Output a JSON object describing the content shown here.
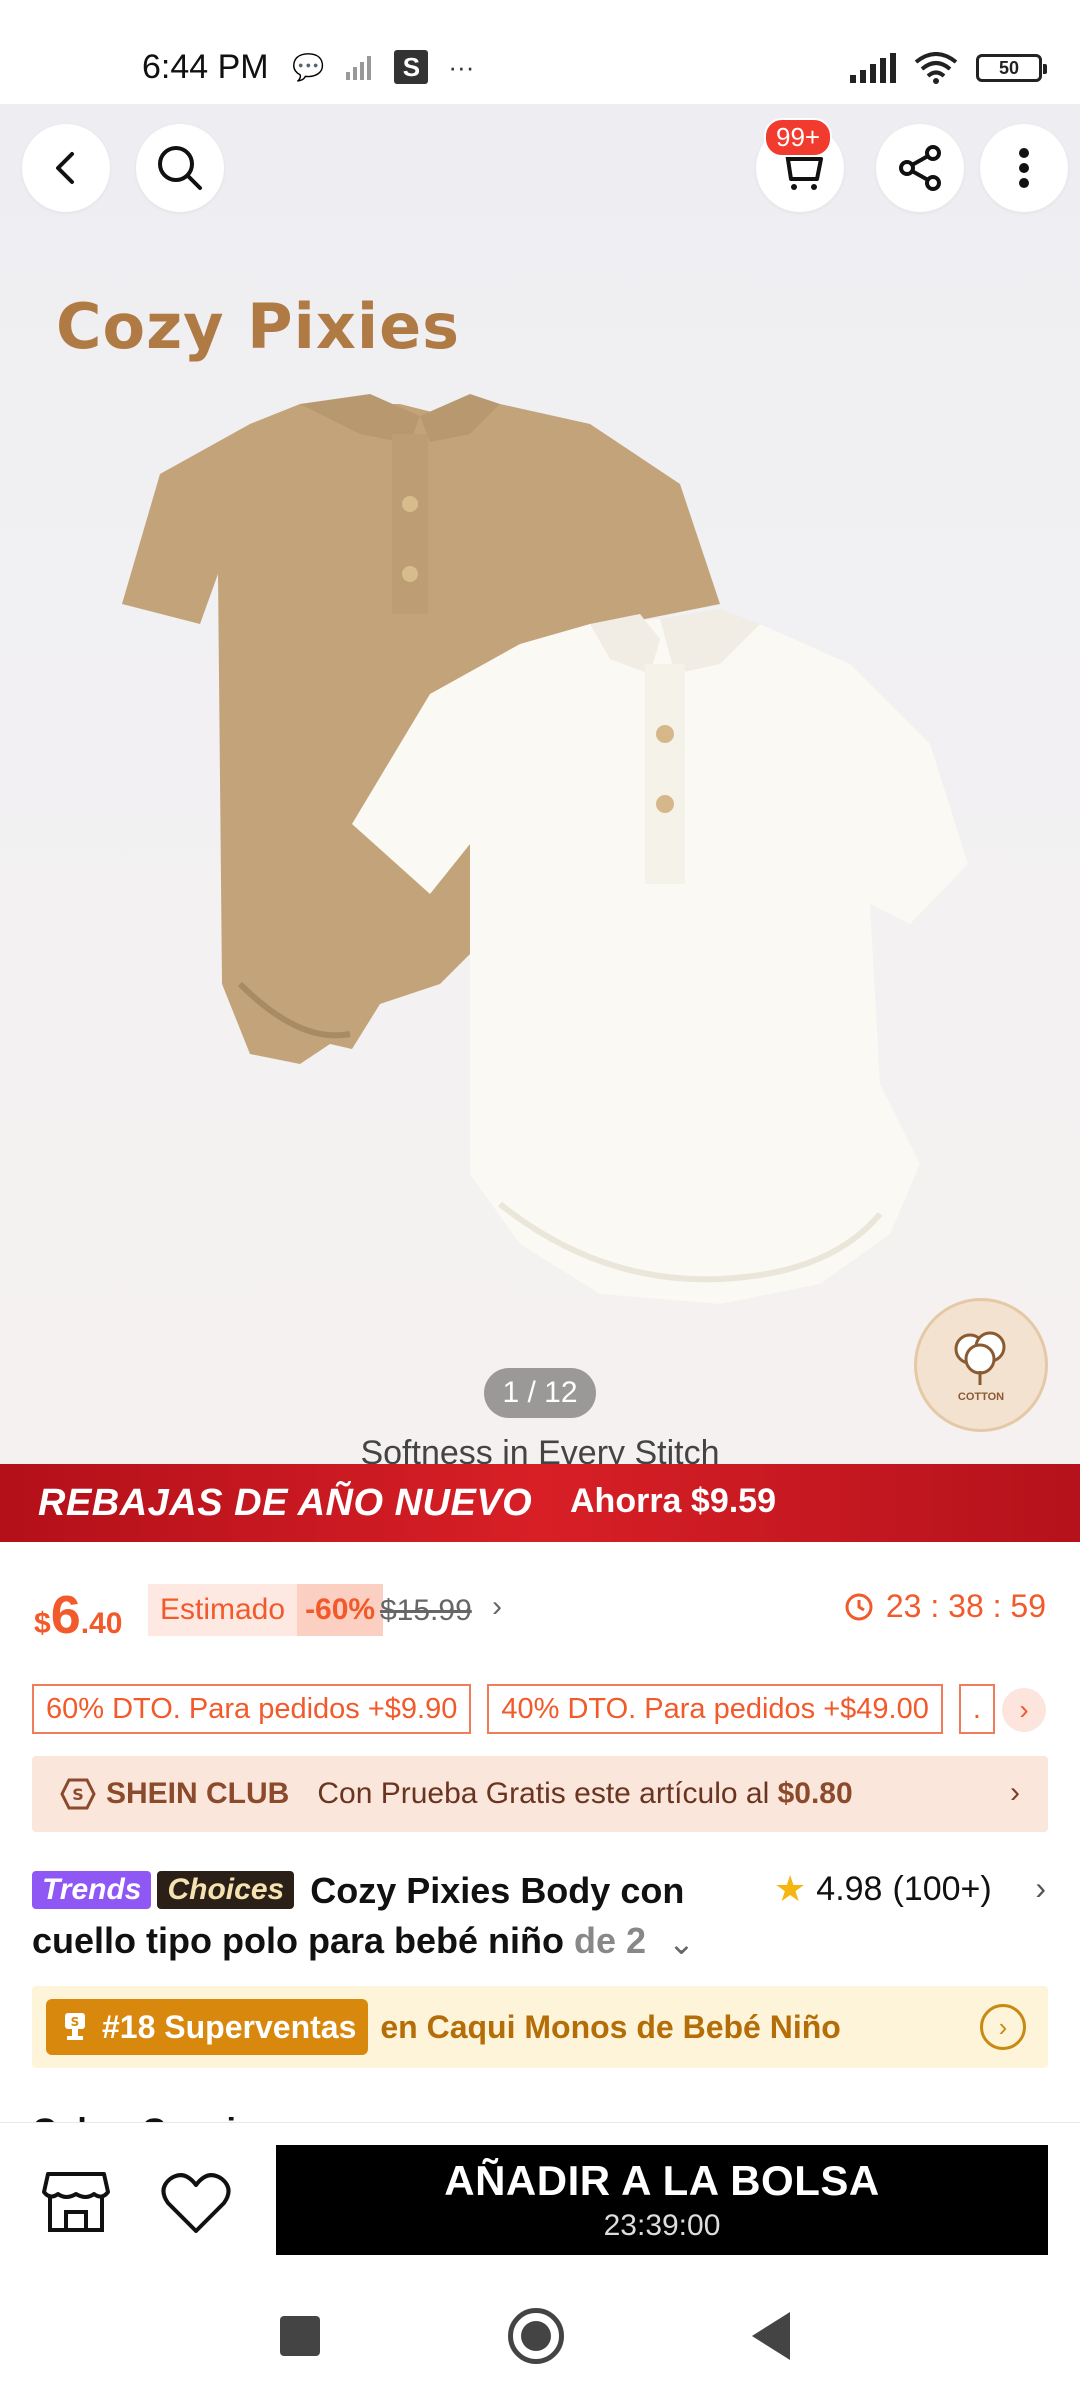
{
  "status_bar": {
    "time": "6:44 PM",
    "battery": "50"
  },
  "header": {
    "cart_badge": "99+"
  },
  "gallery": {
    "brand_logo": "Cozy Pixies",
    "counter": "1 / 12",
    "caption": "Softness in Every Stitch",
    "cotton_badge": "COTTON"
  },
  "promo": {
    "title": "REBAJAS DE AÑO NUEVO",
    "saving": "Ahorra $9.59"
  },
  "price": {
    "currency": "$",
    "integer": "6",
    "decimal": ".40",
    "estimate_label": "Estimado",
    "discount": "-60%",
    "original": "$15.99",
    "timer": "23 : 38 : 59"
  },
  "coupons": [
    "60% DTO. Para pedidos +$9.90",
    "40% DTO. Para pedidos +$49.00",
    "."
  ],
  "club": {
    "name": "SHEIN CLUB",
    "text": "Con Prueba Gratis este artículo al ",
    "price": "$0.80"
  },
  "product": {
    "tag_trends": "Trends",
    "tag_choices": "Choices",
    "title": "Cozy Pixies Body con cuello tipo polo para bebé niño",
    "title_fade": " de 2",
    "rating": "4.98",
    "rating_count": "(100+)"
  },
  "bestseller": {
    "rank": "#18 Superventas",
    "category": "en Caqui Monos de Bebé Niño"
  },
  "section_peek": "Color: Caqui",
  "action_bar": {
    "add_to_bag": "AÑADIR A LA BOLSA",
    "countdown": "23:39:00"
  },
  "colors": {
    "accent": "#f25a2b",
    "promo_red": "#d81f26",
    "gold": "#d9880e"
  }
}
